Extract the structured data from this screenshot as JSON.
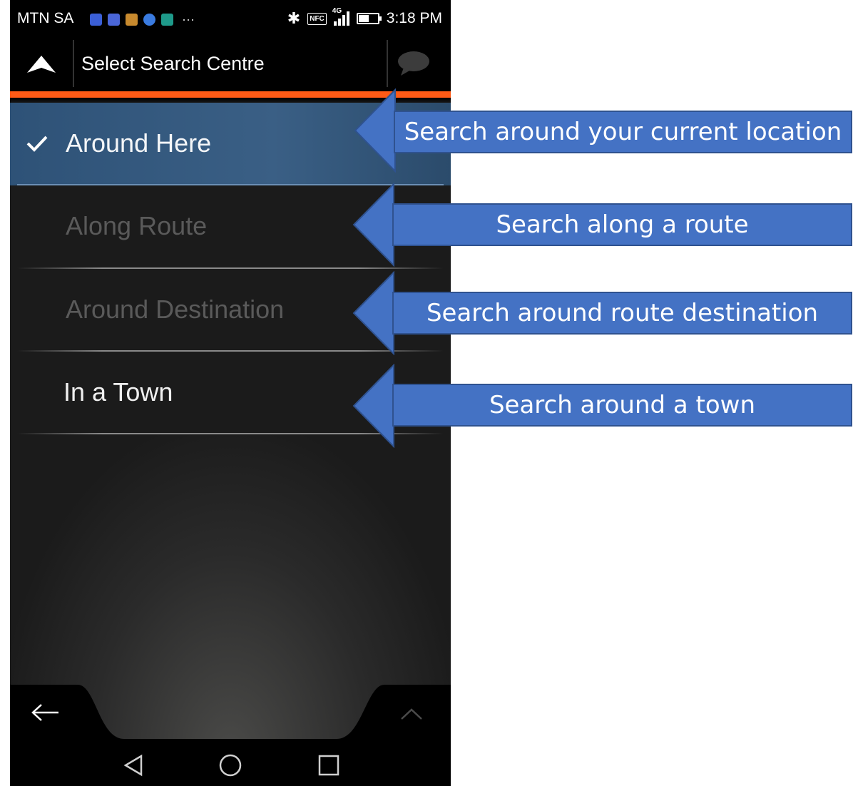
{
  "status_bar": {
    "carrier": "MTN SA",
    "time": "3:18 PM",
    "network": "4G",
    "nfc": "NFC",
    "overflow": "···",
    "notification_icons": [
      {
        "name": "location-app-icon",
        "color": "#3b5fd6"
      },
      {
        "name": "link-app-icon",
        "color": "#4a66d8"
      },
      {
        "name": "wallet-app-icon",
        "color": "#c88a2e"
      },
      {
        "name": "drive-app-icon",
        "color": "#3a7be0"
      },
      {
        "name": "gallery-app-icon",
        "color": "#1e9a8a"
      }
    ]
  },
  "header": {
    "title": "Select Search Centre",
    "up_icon": "up-arrow-icon",
    "chat_icon": "speech-bubble-icon"
  },
  "menu": {
    "items": [
      {
        "label": "Around Here",
        "state": "selected"
      },
      {
        "label": "Along Route",
        "state": "disabled"
      },
      {
        "label": "Around Destination",
        "state": "disabled"
      },
      {
        "label": "In a Town",
        "state": "enabled"
      }
    ]
  },
  "callouts": [
    "Search around your current location",
    "Search along a route",
    "Search around route destination",
    "Search around a town"
  ],
  "colors": {
    "accent_orange": "#ff5a16",
    "selected_blue": "#2e5277",
    "callout_blue": "#4472c4"
  }
}
